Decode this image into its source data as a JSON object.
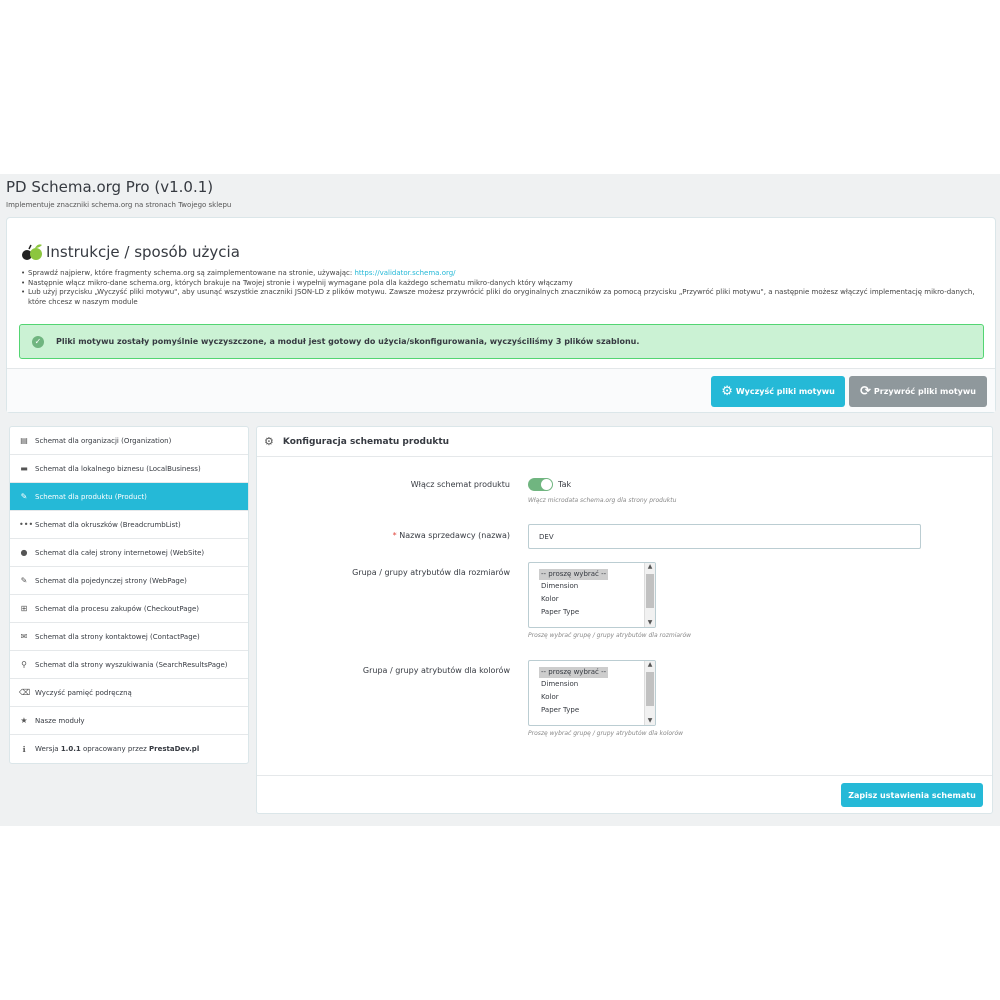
{
  "header": {
    "title": "PD Schema.org Pro (v1.0.1)",
    "subtitle": "Implementuje znaczniki schema.org na stronach Twojego sklepu"
  },
  "instructions": {
    "title": "Instrukcje / sposób użycia",
    "line1_text": "Sprawdź najpierw, które fragmenty schema.org są zaimplementowane na stronie, używając: ",
    "line1_link": "https://validator.schema.org/",
    "line2": "Następnie włącz mikro-dane schema.org, których brakuje na Twojej stronie i wypełnij wymagane pola dla każdego schematu mikro-danych który włączamy",
    "line3": "Lub użyj przycisku „Wyczyść pliki motywu\", aby usunąć wszystkie znaczniki JSON-LD z plików motywu. Zawsze możesz przywrócić pliki do oryginalnych znaczników za pomocą przycisku „Przywróć pliki motywu\", a następnie możesz włączyć implementację mikro-danych, które chcesz w naszym module"
  },
  "alert": {
    "message": "Pliki motywu zostały pomyślnie wyczyszczone, a moduł jest gotowy do użycia/skonfigurowania, wyczyściliśmy 3 plików szablonu."
  },
  "buttons": {
    "clean": "Wyczyść pliki motywu",
    "restore": "Przywróć pliki motywu",
    "save": "Zapisz ustawienia schematu"
  },
  "sidebar": {
    "items": [
      {
        "label": "Schemat dla organizacji (Organization)"
      },
      {
        "label": "Schemat dla lokalnego biznesu (LocalBusiness)"
      },
      {
        "label": "Schemat dla produktu (Product)"
      },
      {
        "label": "Schemat dla okruszków (BreadcrumbList)"
      },
      {
        "label": "Schemat dla całej strony internetowej (WebSite)"
      },
      {
        "label": "Schemat dla pojedynczej strony (WebPage)"
      },
      {
        "label": "Schemat dla procesu zakupów (CheckoutPage)"
      },
      {
        "label": "Schemat dla strony kontaktowej (ContactPage)"
      },
      {
        "label": "Schemat dla strony wyszukiwania (SearchResultsPage)"
      },
      {
        "label": "Wyczyść pamięć podręczną"
      },
      {
        "label": "Nasze moduły"
      }
    ],
    "version_prefix": "Wersja ",
    "version": "1.0.1",
    "version_mid": " opracowany przez ",
    "author": "PrestaDev.pl"
  },
  "config": {
    "title": "Konfiguracja schematu produktu",
    "enable_label": "Włącz schemat produktu",
    "enable_value": "Tak",
    "enable_help": "Włącz microdata schema.org dla strony produktu",
    "seller_label": "Nazwa sprzedawcy (nazwa)",
    "seller_value": "DEV",
    "size_label": "Grupa / grupy atrybutów dla rozmiarów",
    "size_help": "Proszę wybrać grupę / grupy atrybutów dla rozmiarów",
    "color_label": "Grupa / grupy atrybutów dla kolorów",
    "color_help": "Proszę wybrać grupę / grupy atrybutów dla kolorów",
    "options": [
      "-- proszę wybrać --",
      "Dimension",
      "Kolor",
      "Paper Type"
    ]
  },
  "colors": {
    "accent": "#25b9d7",
    "success_bg": "#cbf2d4",
    "toggle_on": "#70b580"
  }
}
